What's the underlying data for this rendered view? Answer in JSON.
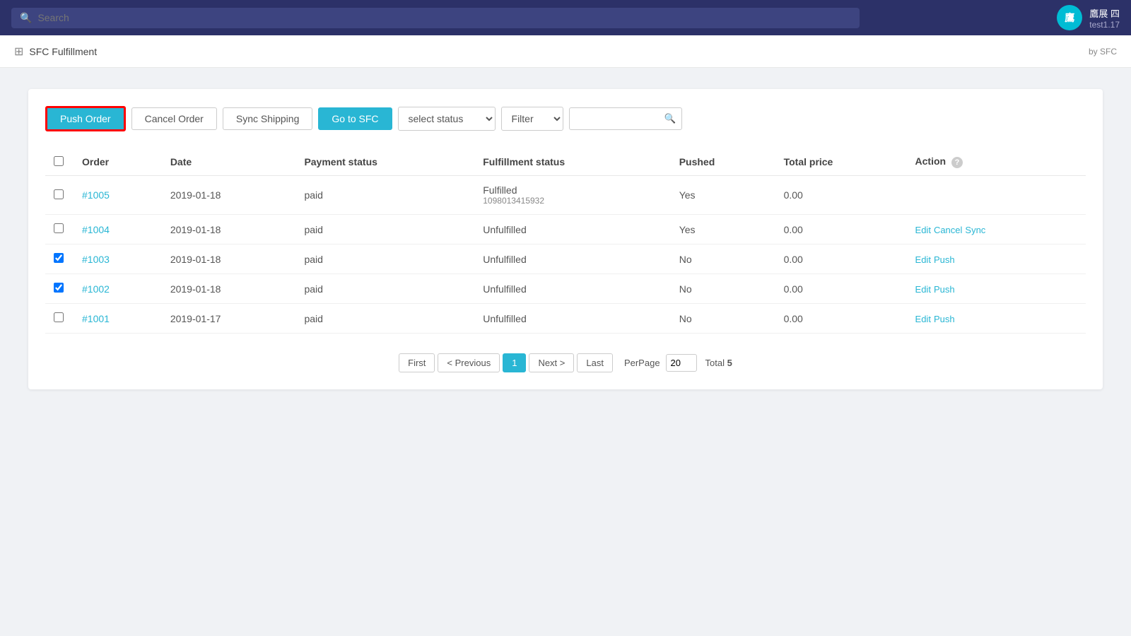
{
  "topNav": {
    "searchPlaceholder": "Search",
    "userName": "鷹展 四",
    "userSub": "test1.17",
    "avatarInitial": "鷹"
  },
  "subNav": {
    "appName": "SFC Fulfillment",
    "byLabel": "by SFC"
  },
  "toolbar": {
    "pushOrderLabel": "Push Order",
    "cancelOrderLabel": "Cancel Order",
    "syncShippingLabel": "Sync Shipping",
    "goToSFCLabel": "Go to SFC",
    "selectStatusDefault": "select status",
    "filterLabel": "Filter",
    "searchPlaceholder": ""
  },
  "table": {
    "headers": {
      "order": "Order",
      "date": "Date",
      "paymentStatus": "Payment status",
      "fulfillmentStatus": "Fulfillment status",
      "pushed": "Pushed",
      "totalPrice": "Total price",
      "action": "Action"
    },
    "rows": [
      {
        "id": "row-1005",
        "orderNum": "#1005",
        "date": "2019-01-18",
        "payment": "paid",
        "fulfillment": "Fulfilled",
        "fulfillmentSub": "1098013415932",
        "pushed": "Yes",
        "totalPrice": "0.00",
        "actions": [],
        "checked": false
      },
      {
        "id": "row-1004",
        "orderNum": "#1004",
        "date": "2019-01-18",
        "payment": "paid",
        "fulfillment": "Unfulfilled",
        "fulfillmentSub": "",
        "pushed": "Yes",
        "totalPrice": "0.00",
        "actions": [
          "Edit",
          "Cancel",
          "Sync"
        ],
        "checked": false
      },
      {
        "id": "row-1003",
        "orderNum": "#1003",
        "date": "2019-01-18",
        "payment": "paid",
        "fulfillment": "Unfulfilled",
        "fulfillmentSub": "",
        "pushed": "No",
        "totalPrice": "0.00",
        "actions": [
          "Edit",
          "Push"
        ],
        "checked": true
      },
      {
        "id": "row-1002",
        "orderNum": "#1002",
        "date": "2019-01-18",
        "payment": "paid",
        "fulfillment": "Unfulfilled",
        "fulfillmentSub": "",
        "pushed": "No",
        "totalPrice": "0.00",
        "actions": [
          "Edit",
          "Push"
        ],
        "checked": true
      },
      {
        "id": "row-1001",
        "orderNum": "#1001",
        "date": "2019-01-17",
        "payment": "paid",
        "fulfillment": "Unfulfilled",
        "fulfillmentSub": "",
        "pushed": "No",
        "totalPrice": "0.00",
        "actions": [
          "Edit",
          "Push"
        ],
        "checked": false
      }
    ]
  },
  "pagination": {
    "firstLabel": "First",
    "prevLabel": "< Previous",
    "currentPage": "1",
    "nextLabel": "Next >",
    "lastLabel": "Last",
    "perPageLabel": "PerPage",
    "perPageValue": "20",
    "totalLabel": "Total",
    "totalValue": "5"
  }
}
